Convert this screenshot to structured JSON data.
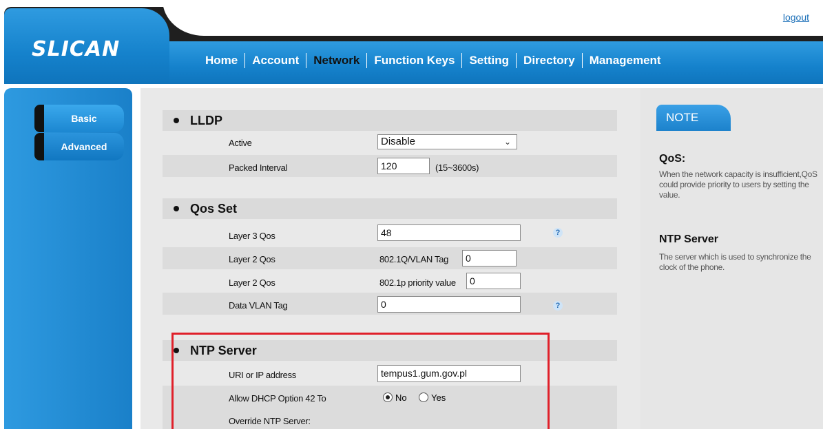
{
  "header": {
    "logo": "SLICAN",
    "logout": "logout",
    "nav": [
      "Home",
      "Account",
      "Network",
      "Function Keys",
      "Setting",
      "Directory",
      "Management"
    ],
    "active_nav": "Network"
  },
  "sidebar": {
    "items": [
      {
        "label": "Basic"
      },
      {
        "label": "Advanced"
      }
    ]
  },
  "sections": {
    "lldp": {
      "title": "LLDP",
      "active_label": "Active",
      "active_value": "Disable",
      "packet_interval_label": "Packed Interval",
      "packet_interval_value": "120",
      "packet_interval_range": "(15~3600s)"
    },
    "qos": {
      "title": "Qos Set",
      "layer3_label": "Layer 3 Qos",
      "layer3_value": "48",
      "layer2_vlan_label": "Layer 2 Qos",
      "layer2_vlan_prefix": "802.1Q/VLAN Tag",
      "layer2_vlan_value": "0",
      "layer2_priority_label": "Layer 2 Qos",
      "layer2_priority_prefix": "802.1p priority value",
      "layer2_priority_value": "0",
      "data_vlan_label": "Data VLAN Tag",
      "data_vlan_value": "0"
    },
    "ntp": {
      "title": "NTP Server",
      "uri_label": "URI or IP address",
      "uri_value": "tempus1.gum.gov.pl",
      "dhcp_label_1": "Allow DHCP Option 42 To",
      "dhcp_label_2": "Override NTP Server:",
      "opt_no": "No",
      "opt_yes": "Yes",
      "selected": "No"
    }
  },
  "note": {
    "tab": "NOTE",
    "items": [
      {
        "title": "QoS:",
        "body": "When the network capacity is insufficient,QoS could provide priority to users by setting the value."
      },
      {
        "title": "NTP Server",
        "body": "The server which is used to synchronize the clock of the phone."
      }
    ]
  }
}
